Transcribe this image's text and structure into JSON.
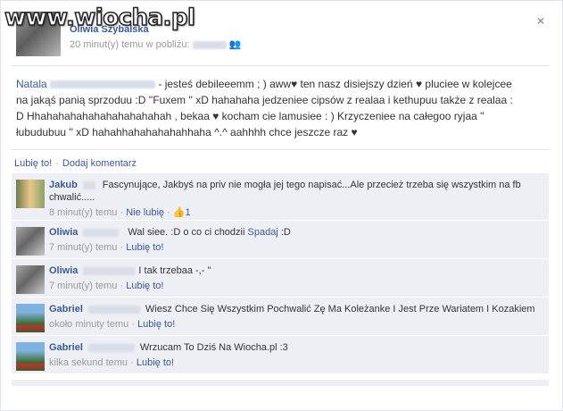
{
  "watermark": "www.wiocha.pl",
  "close_label": "×",
  "post": {
    "author": "Oliwia Szybalska",
    "time": "20 minut(y) temu w pobliżu:",
    "body_name": "Natala",
    "body_text": " - jesteś debileeemm ; ) aww♥ ten nasz disiejszy dzień ♥ pluciee w kolejcee na jakąś panią sprzoduu :D ''Fuxem '' xD hahahaha jedzeniee cipsów z realaa i kethupuu także z realaa : D Hhahahahahahahahahahahah , bekaa ♥ kocham cie lamusiee : ) Krzyczeniee na całegoo ryjaa '' łubudubuu '' xD hahahhahahahahahhaha ^.^ aahhhh chce jeszcze raz ♥",
    "like": "Lubię to!",
    "comment": "Dodaj komentarz",
    "sep": "·"
  },
  "comments": [
    {
      "author": "Jakub",
      "text": "Fascynujące, Jakbyś na priv nie mogła jej tego napisać...Ale przecież trzeba się wszystkim na fb chwalić.....",
      "time": "8 minut(y) temu",
      "action": "Nie lubię",
      "likes": "1"
    },
    {
      "author": "Oliwia",
      "text": "Wal siee. :D o co ci chodzii",
      "text_link": "Spadaj",
      "text_after": ":D",
      "time": "7 minut(y) temu",
      "action": "Lubię to!"
    },
    {
      "author": "Oliwia",
      "text": "I tak trzebaa -,- ''",
      "time": "7 minut(y) temu",
      "action": "Lubię to!"
    },
    {
      "author": "Gabriel",
      "text": "Wiesz Chce Się Wszystkim Pochwalić Zę Ma Koleżanke I Jest Prze Wariatem I Kozakiem",
      "time": "około minuty temu",
      "action": "Lubię to!"
    },
    {
      "author": "Gabriel",
      "text": "Wrzucam To Dziś Na Wiocha.pl :3",
      "time": "kilka sekund temu",
      "action": "Lubię to!"
    }
  ]
}
